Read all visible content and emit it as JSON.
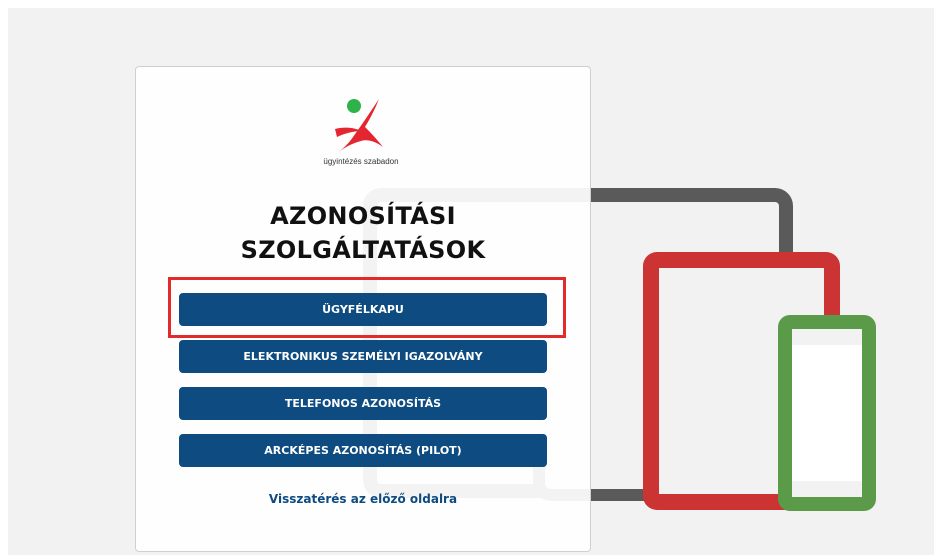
{
  "logo": {
    "caption": "ügyintézés szabadon"
  },
  "title": {
    "line1": "AZONOSÍTÁSI",
    "line2": "SZOLGÁLTATÁSOK"
  },
  "buttons": [
    {
      "label": "ÜGYFÉLKAPU"
    },
    {
      "label": "ELEKTRONIKUS SZEMÉLYI IGAZOLVÁNY"
    },
    {
      "label": "TELEFONOS AZONOSÍTÁS"
    },
    {
      "label": "ARCKÉPES AZONOSÍTÁS (PILOT)"
    }
  ],
  "back_link": "Visszatérés az előző oldalra",
  "colors": {
    "button": "#0d4b80",
    "highlight": "#e22a2a",
    "laptop": "#5a5a5a",
    "tablet": "#cc3333",
    "phone": "#5a9a49"
  }
}
